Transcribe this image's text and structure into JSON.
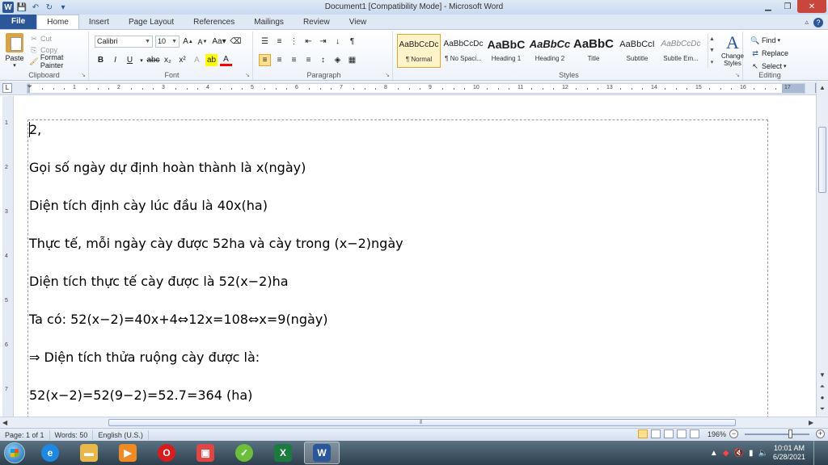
{
  "window": {
    "title": "Document1 [Compatibility Mode]  -  Microsoft Word",
    "minimize_label": "▁",
    "restore_label": "❐",
    "close_label": "✕"
  },
  "tabs": [
    "File",
    "Home",
    "Insert",
    "Page Layout",
    "References",
    "Mailings",
    "Review",
    "View"
  ],
  "clipboard": {
    "paste_label": "Paste",
    "cut_label": "Cut",
    "copy_label": "Copy",
    "format_painter_label": "Format Painter",
    "group_label": "Clipboard"
  },
  "font": {
    "font_name": "Calibri",
    "font_size": "10",
    "group_label": "Font"
  },
  "paragraph": {
    "group_label": "Paragraph"
  },
  "styles": {
    "items": [
      {
        "sample": "AaBbCcDc",
        "name": "¶ Normal"
      },
      {
        "sample": "AaBbCcDc",
        "name": "¶ No Spaci..."
      },
      {
        "sample": "AaBbC",
        "name": "Heading 1"
      },
      {
        "sample": "AaBbCc",
        "name": "Heading 2"
      },
      {
        "sample": "AaBbC",
        "name": "Title"
      },
      {
        "sample": "AaBbCcI",
        "name": "Subtitle"
      },
      {
        "sample": "AaBbCcDc",
        "name": "Subtle Em..."
      }
    ],
    "change_styles_label_1": "Change",
    "change_styles_label_2": "Styles",
    "group_label": "Styles"
  },
  "editing": {
    "find_label": "Find",
    "replace_label": "Replace",
    "select_label": "Select",
    "group_label": "Editing"
  },
  "ruler": {
    "ticks": [
      "1",
      "2",
      "3",
      "4",
      "5",
      "6",
      "7",
      "8",
      "9",
      "10",
      "11",
      "12",
      "13",
      "14",
      "15",
      "16",
      "17"
    ],
    "vticks": [
      "1",
      "2",
      "3",
      "4",
      "5",
      "6",
      "7"
    ]
  },
  "document": {
    "lines": [
      "2,",
      "Gọi số ngày dự định hoàn thành là x(ngày)",
      "Diện tích định cày lúc đầu là 40x(ha)",
      "Thực tế, mỗi ngày cày được 52ha và cày trong (x−2)ngày",
      "Diện tích thực tế cày được là 52(x−2)ha",
      "Ta có: 52(x−2)=40x+4⇔12x=108⇔x=9(ngày)",
      "⇒ Diện tích thửa ruộng cày được là:",
      "52(x−2)=52(9−2)=52.7=364  (ha)"
    ]
  },
  "statusbar": {
    "page": "Page: 1 of 1",
    "words": "Words: 50",
    "language": "English (U.S.)",
    "zoom": "196%"
  },
  "taskbar": {
    "time": "10:01 AM",
    "date": "6/28/2021"
  },
  "colors": {
    "accent": "#2b579a",
    "close": "#c9463d"
  }
}
